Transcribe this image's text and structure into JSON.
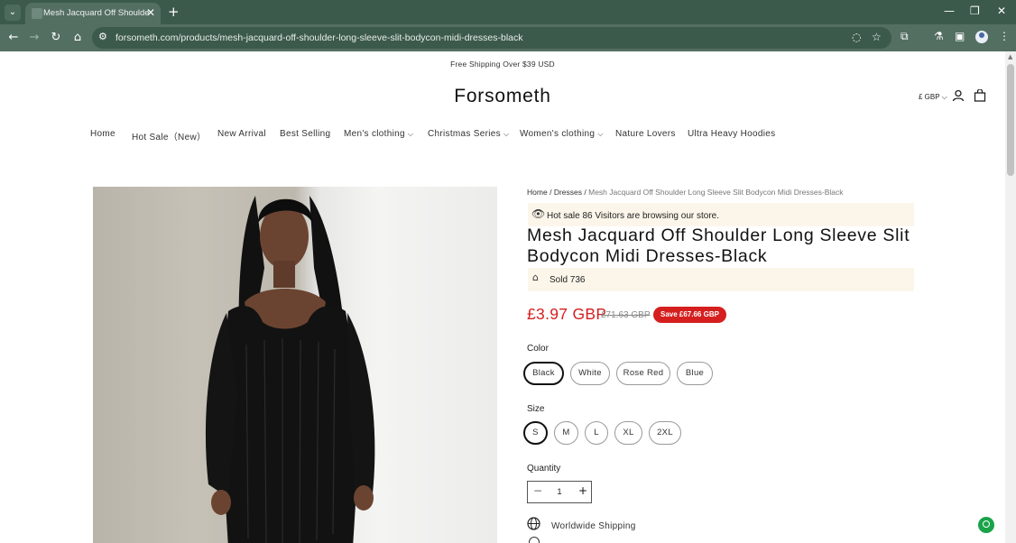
{
  "browser": {
    "tab_title": "Mesh Jacquard Off Shoulder Lo",
    "url": "forsometh.com/products/mesh-jacquard-off-shoulder-long-sleeve-slit-bodycon-midi-dresses-black",
    "icons": [
      "chevron-down-icon",
      "close-icon",
      "plus-icon",
      "back-icon",
      "forward-icon",
      "reload-icon",
      "home-icon",
      "site-info-icon",
      "eye-off-icon",
      "star-icon",
      "extensions-icon",
      "labs-icon",
      "side-panel-icon",
      "profile-icon",
      "menu-icon"
    ]
  },
  "announcement": "Free Shipping Over $39 USD",
  "logo": "Forsometh",
  "header": {
    "currency": "£ GBP"
  },
  "menu": [
    {
      "label": "Home",
      "dropdown": false
    },
    {
      "label": "Hot Sale（New）",
      "dropdown": false
    },
    {
      "label": "New Arrival",
      "dropdown": false
    },
    {
      "label": "Best Selling",
      "dropdown": false
    },
    {
      "label": "Men's clothing",
      "dropdown": true
    },
    {
      "label": "Christmas Series",
      "dropdown": true
    },
    {
      "label": "Women's clothing",
      "dropdown": true
    },
    {
      "label": "Nature Lovers",
      "dropdown": false
    },
    {
      "label": "Ultra Heavy Hoodies",
      "dropdown": false
    }
  ],
  "breadcrumb": {
    "home": "Home",
    "sep": "/",
    "category": "Dresses",
    "current": "Mesh Jacquard Off Shoulder Long Sleeve Slit Bodycon Midi Dresses-Black"
  },
  "product": {
    "visitors": "Hot sale 86 Visitors are browsing our store.",
    "title": "Mesh Jacquard Off Shoulder Long Sleeve Slit Bodycon Midi Dresses-Black",
    "sold": "Sold 736",
    "price": "£3.97 GBP",
    "compare_price": "£71.63 GBP",
    "save": "Save £67.66 GBP",
    "color_label": "Color",
    "colors": [
      "Black",
      "White",
      "Rose Red",
      "Blue"
    ],
    "selected_color": "Black",
    "size_label": "Size",
    "sizes": [
      "S",
      "M",
      "L",
      "XL",
      "2XL"
    ],
    "selected_size": "S",
    "quantity_label": "Quantity",
    "quantity": "1",
    "shipping": "Worldwide Shipping"
  },
  "colors": {
    "chrome": "#3c5a4c",
    "toolbar": "#536f62",
    "price": "#d51f1f",
    "info_bg": "#fcf6ea",
    "chat": "#1aa34a"
  }
}
